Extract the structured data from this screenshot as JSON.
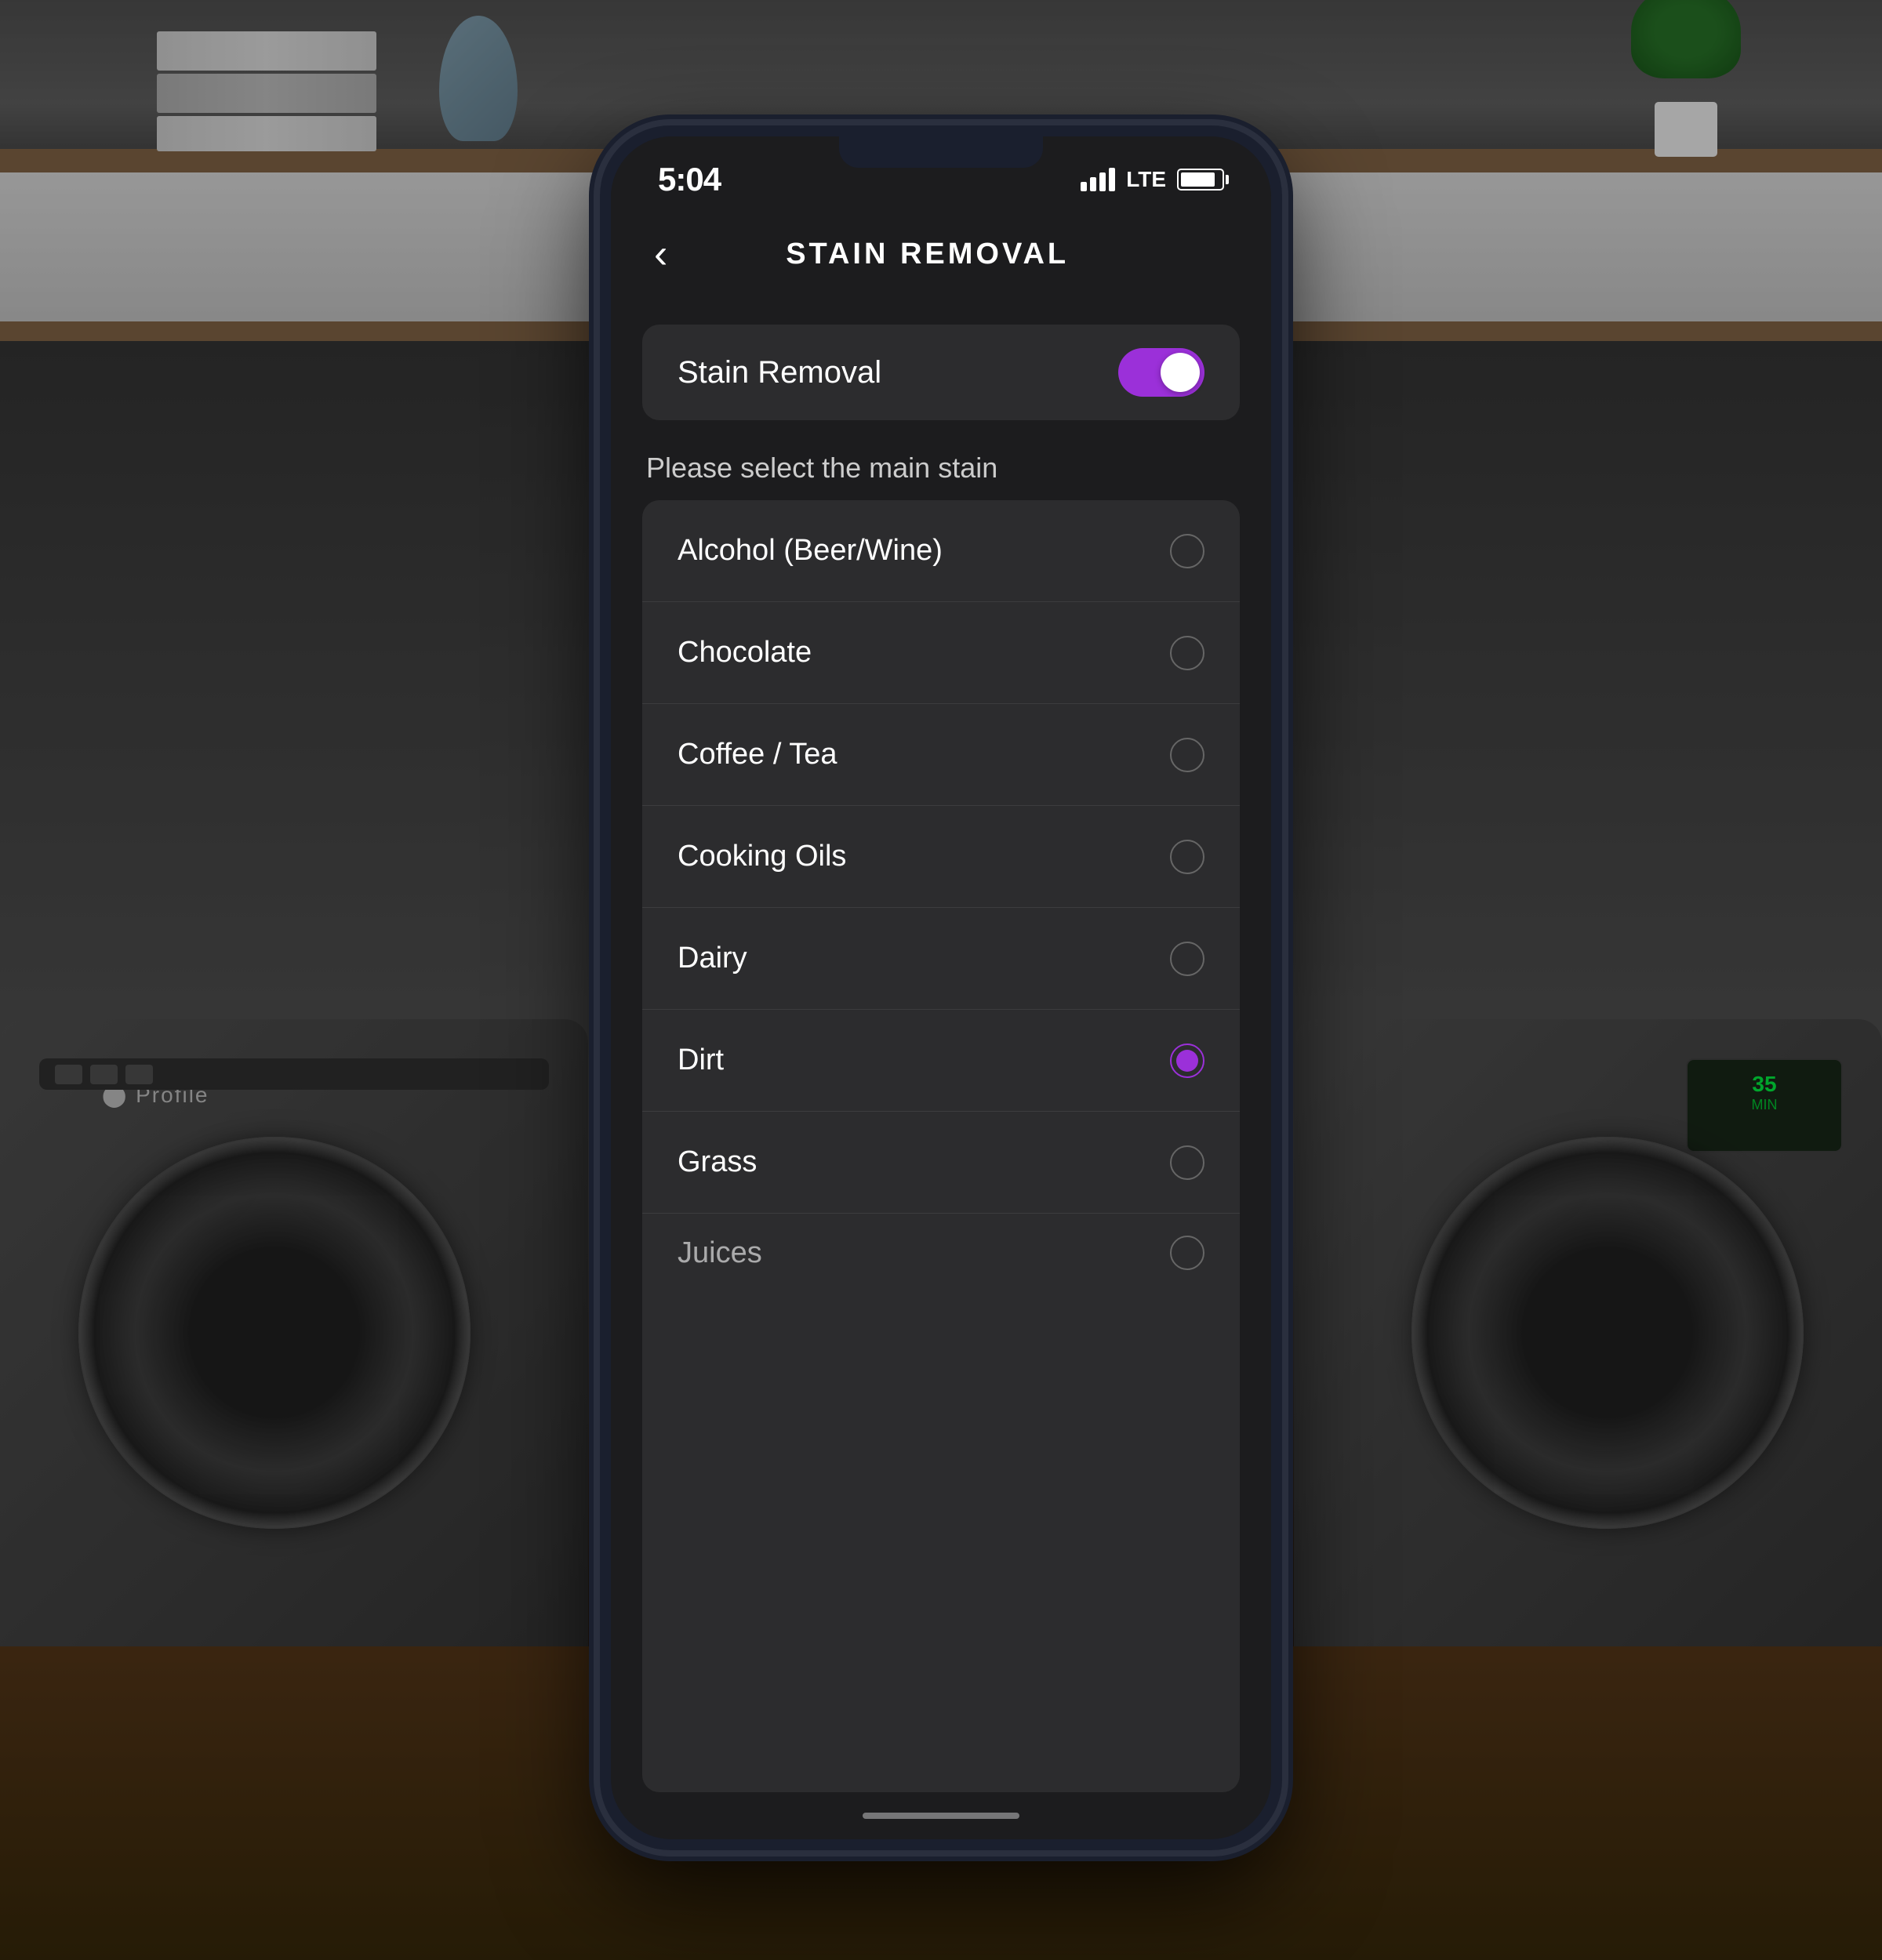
{
  "background": {
    "description": "Laundry room with two dark washing machines"
  },
  "status_bar": {
    "time": "5:04",
    "lte_label": "LTE"
  },
  "nav": {
    "back_label": "‹",
    "title": "STAIN REMOVAL"
  },
  "toggle": {
    "label": "Stain Removal",
    "is_on": true
  },
  "stain_select": {
    "prompt": "Please select the main stain",
    "items": [
      {
        "name": "Alcohol (Beer/Wine)",
        "selected": false
      },
      {
        "name": "Chocolate",
        "selected": false
      },
      {
        "name": "Coffee / Tea",
        "selected": false
      },
      {
        "name": "Cooking Oils",
        "selected": false
      },
      {
        "name": "Dairy",
        "selected": false
      },
      {
        "name": "Dirt",
        "selected": true
      },
      {
        "name": "Grass",
        "selected": false
      },
      {
        "name": "Juices",
        "selected": false
      }
    ]
  },
  "colors": {
    "accent": "#9b30d9",
    "bg_dark": "#1c1c1e",
    "card_bg": "#2c2c2e"
  },
  "washers": {
    "left_brand": "⬤ Profile",
    "right_brand": ""
  }
}
